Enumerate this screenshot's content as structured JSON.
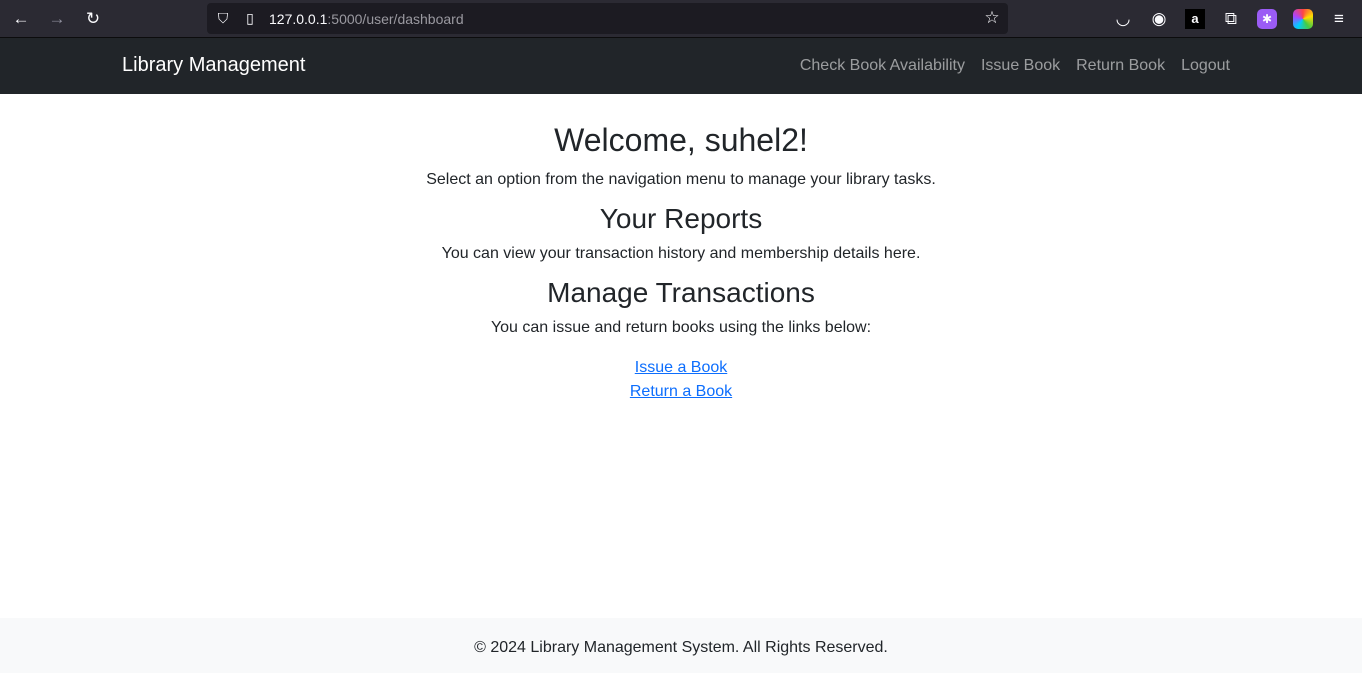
{
  "browser": {
    "url_host": "127.0.0.1",
    "url_rest": ":5000/user/dashboard",
    "icons": [
      "back-icon",
      "forward-icon",
      "reload-icon",
      "shield-icon",
      "page-icon",
      "star-icon",
      "pocket-icon",
      "account-icon",
      "amazon-icon",
      "extensions-icon",
      "extension-purple-icon",
      "extension-color-icon",
      "menu-icon"
    ]
  },
  "navbar": {
    "brand": "Library Management",
    "links": [
      "Check Book Availability",
      "Issue Book",
      "Return Book",
      "Logout"
    ]
  },
  "main": {
    "welcome": "Welcome, suhel2!",
    "intro": "Select an option from the navigation menu to manage your library tasks.",
    "reports_title": "Your Reports",
    "reports_text": "You can view your transaction history and membership details here.",
    "manage_title": "Manage Transactions",
    "manage_text": "You can issue and return books using the links below:",
    "links": [
      "Issue a Book",
      "Return a Book"
    ]
  },
  "footer": {
    "text": "© 2024 Library Management System. All Rights Reserved."
  }
}
